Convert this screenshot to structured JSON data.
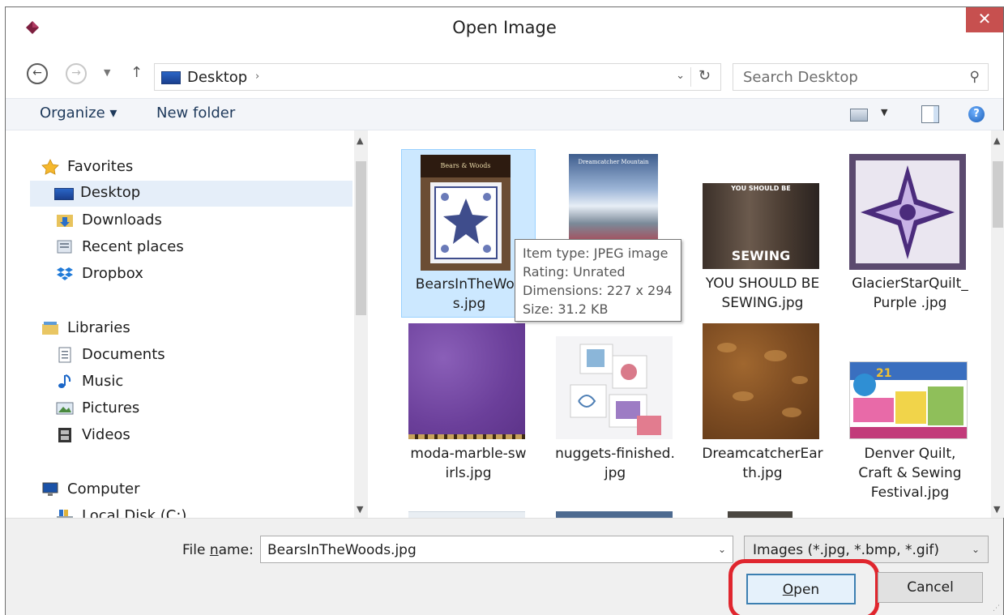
{
  "window": {
    "title": "Open Image",
    "close_glyph": "✕"
  },
  "nav": {
    "back_glyph": "←",
    "forward_glyph": "→",
    "recent_glyph": "▼",
    "up_glyph": "↑",
    "address": "Desktop",
    "address_sep": "›",
    "address_drop": "⌄",
    "refresh_glyph": "↻",
    "search_placeholder": "Search Desktop",
    "search_glyph": "⚲"
  },
  "toolbar": {
    "organize": "Organize ▾",
    "new_folder": "New folder",
    "view_drop": "▼",
    "help": "?"
  },
  "sidebar": {
    "favorites": "Favorites",
    "desktop": "Desktop",
    "downloads": "Downloads",
    "recent_places": "Recent places",
    "dropbox": "Dropbox",
    "libraries": "Libraries",
    "documents": "Documents",
    "music": "Music",
    "pictures": "Pictures",
    "videos": "Videos",
    "computer": "Computer",
    "local_disk": "Local Disk (C:)"
  },
  "files": [
    {
      "name_line1": "BearsInTheWoo",
      "name_line2": "s.jpg",
      "selected": true
    },
    {
      "name_line1": "",
      "name_line2": ""
    },
    {
      "name_line1": "YOU SHOULD BE",
      "name_line2": "SEWING.jpg"
    },
    {
      "name_line1": "GlacierStarQuilt_",
      "name_line2": "Purple .jpg"
    },
    {
      "name_line1": "moda-marble-sw",
      "name_line2": "irls.jpg"
    },
    {
      "name_line1": "nuggets-finished.",
      "name_line2": "jpg"
    },
    {
      "name_line1": "DreamcatcherEar",
      "name_line2": "th.jpg"
    },
    {
      "name_line1": "Denver Quilt,",
      "name_line2": "Craft & Sewing",
      "name_line3": "Festival.jpg"
    }
  ],
  "thumb_text": {
    "bears_title": "Bears & Woods",
    "sewing_top": "YOU SHOULD BE",
    "sewing_bottom": "SEWING",
    "denver_badge": "21",
    "dream_title": "Dreamcatcher Mountain"
  },
  "tooltip": {
    "line1": "Item type: JPEG image",
    "line2": "Rating: Unrated",
    "line3": "Dimensions: 227 x 294",
    "line4": "Size: 31.2 KB"
  },
  "footer": {
    "file_name_label_pre": "File ",
    "file_name_label_u": "n",
    "file_name_label_post": "ame:",
    "file_name_value": "BearsInTheWoods.jpg",
    "filter_value": "Images (*.jpg, *.bmp, *.gif)",
    "drop_glyph": "⌄",
    "open_pre": "",
    "open_u": "O",
    "open_post": "pen",
    "cancel": "Cancel",
    "grip": "⋰"
  },
  "scroll": {
    "up": "▲",
    "down": "▼"
  },
  "colors": {
    "close": "#c7504f",
    "selection": "#cce8ff",
    "highlight_ring": "#e0262e",
    "accent_link": "#1e395b"
  }
}
